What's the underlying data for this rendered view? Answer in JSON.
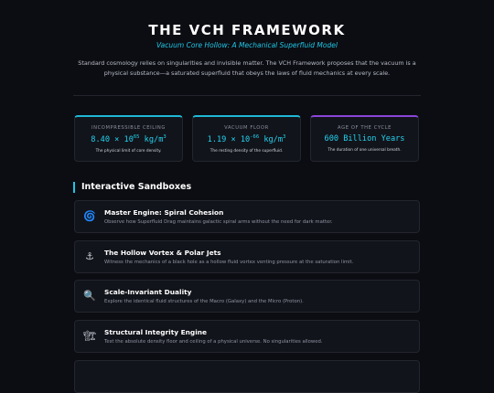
{
  "header": {
    "title": "THE VCH FRAMEWORK",
    "subtitle": "Vacuum Core Hollow: A Mechanical Superfluid Model",
    "intro": "Standard cosmology relies on singularities and invisible matter. The VCH Framework proposes that the vacuum is a physical substance—a saturated superfluid that obeys the laws of fluid mechanics at every scale."
  },
  "stats": [
    {
      "label": "INCOMPRESSIBLE CEILING",
      "value_base": "8.40 × 10",
      "value_exp": "65",
      "value_unit": " kg/m",
      "value_unit_exp": "3",
      "desc": "The physical limit of core density."
    },
    {
      "label": "VACUUM FLOOR",
      "value_base": "1.19 × 10",
      "value_exp": "-66",
      "value_unit": " kg/m",
      "value_unit_exp": "3",
      "desc": "The resting density of the superfluid."
    },
    {
      "label": "AGE OF THE CYCLE",
      "value": "600 Billion Years",
      "desc": "The duration of one universal breath."
    }
  ],
  "sandboxes": {
    "heading": "Interactive Sandboxes",
    "items": [
      {
        "icon": "spiral-icon",
        "glyph": "🌀",
        "title": "Master Engine: Spiral Cohesion",
        "desc": "Observe how Superfluid Drag maintains galactic spiral arms without the need for dark matter."
      },
      {
        "icon": "anchor-icon",
        "glyph": "⚓",
        "title": "The Hollow Vortex & Polar Jets",
        "desc": "Witness the mechanics of a black hole as a hollow fluid vortex venting pressure at the saturation limit."
      },
      {
        "icon": "magnifier-icon",
        "glyph": "🔍",
        "title": "Scale-Invariant Duality",
        "desc": "Explore the identical fluid structures of the Macro (Galaxy) and the Micro (Proton)."
      },
      {
        "icon": "crane-icon",
        "glyph": "🏗",
        "title": "Structural Integrity Engine",
        "desc": "Test the absolute density floor and ceiling of a physical universe. No singularities allowed."
      }
    ]
  },
  "colors": {
    "accent_cyan": "#1ec5e6",
    "accent_purple": "#8b45d9",
    "background": "#0c0d12"
  }
}
